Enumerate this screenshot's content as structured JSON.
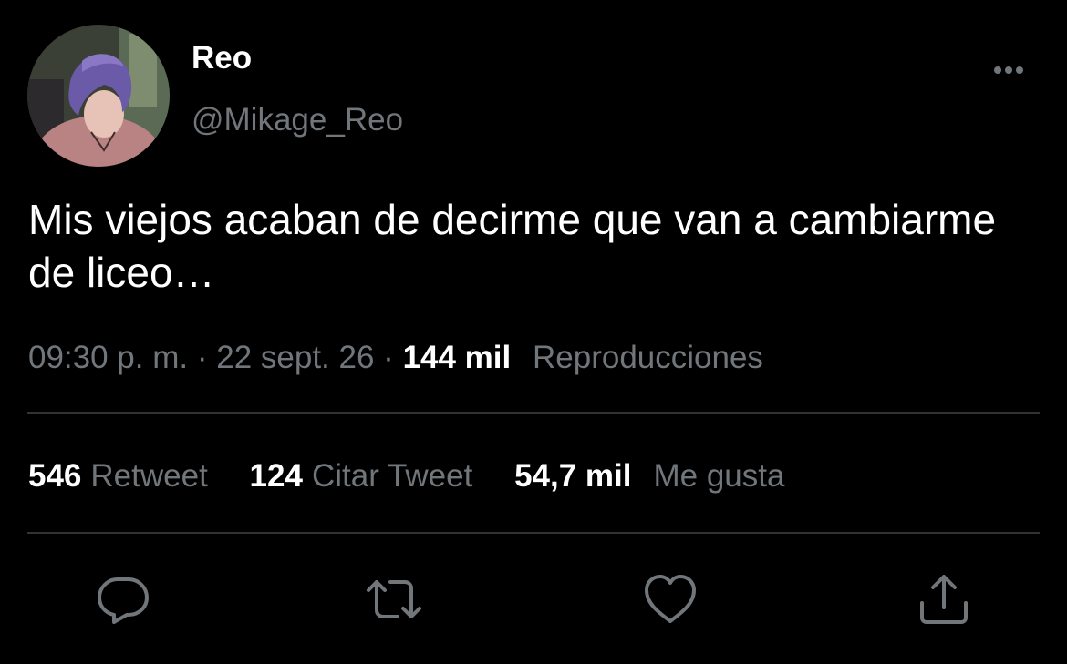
{
  "colors": {
    "background": "#000000",
    "primary_text": "#ffffff",
    "secondary_text": "#71767b",
    "divider": "#2f3336"
  },
  "author": {
    "display_name": "Reo",
    "handle": "@Mikage_Reo",
    "avatar_icon": "avatar-photo-purple-hair"
  },
  "tweet": {
    "text": "Mis viejos acaban de decirme que van a cambiarme de liceo…"
  },
  "meta": {
    "time": "09:30 p. m.",
    "separator": "·",
    "date": "22 sept. 26",
    "views_count": "144 mil",
    "views_label": "Reproducciones"
  },
  "stats": {
    "retweets_count": "546",
    "retweets_label": "Retweet",
    "quotes_count": "124",
    "quotes_label": "Citar Tweet",
    "likes_count": "54,7 mil",
    "likes_label": "Me gusta"
  },
  "icons": {
    "more": "more-horizontal-icon",
    "reply": "reply-icon",
    "retweet": "retweet-icon",
    "like": "heart-icon",
    "share": "share-icon"
  }
}
